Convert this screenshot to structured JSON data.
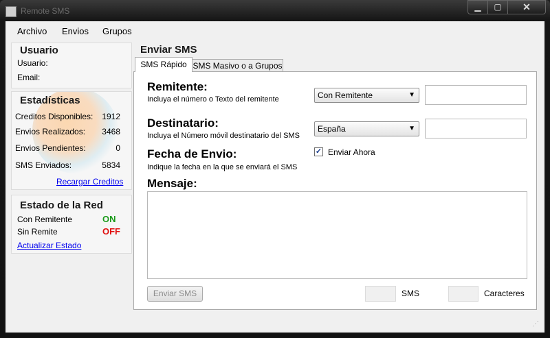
{
  "window": {
    "title": "Remote SMS"
  },
  "titlebar": {
    "min": "▁",
    "max": "▢",
    "close": "✕"
  },
  "menu": [
    "Archivo",
    "Envios",
    "Grupos"
  ],
  "usuario": {
    "title": "Usuario",
    "usuario_label": "Usuario:",
    "email_label": "Email:"
  },
  "estadisticas": {
    "title": "Estadísticas",
    "rows": [
      {
        "label": "Creditos Disponibles:",
        "value": "1912"
      },
      {
        "label": "Envios Realizados:",
        "value": "3468"
      },
      {
        "label": "Envios Pendientes:",
        "value": "0"
      },
      {
        "label": "SMS Enviados:",
        "value": "5834"
      }
    ],
    "link": "Recargar Creditos"
  },
  "red": {
    "title": "Estado de la Red",
    "rows": [
      {
        "label": "Con Remitente",
        "status": "ON",
        "color": "#1a9a1a"
      },
      {
        "label": "Sin Remite",
        "status": "OFF",
        "color": "#e01010"
      }
    ],
    "link": "Actualizar Estado"
  },
  "enviar": {
    "title": "Enviar SMS",
    "tabs": [
      "SMS Rápido",
      "SMS Masivo o a Grupos"
    ],
    "remitente": {
      "title": "Remitente:",
      "desc": "Incluya el número o Texto del remitente",
      "select": "Con Remitente",
      "input": ""
    },
    "destinatario": {
      "title": "Destinatario:",
      "desc": "Incluya el Número móvil destinatario del SMS",
      "select": "España",
      "input": ""
    },
    "fecha": {
      "title": "Fecha de Envio:",
      "desc": "Indique la fecha en la que se enviará el SMS",
      "checkbox_label": "Enviar Ahora",
      "checked": true
    },
    "mensaje": {
      "title": "Mensaje:",
      "value": ""
    },
    "send_button": "Enviar SMS",
    "sms_label": "SMS",
    "chars_label": "Caracteres"
  }
}
